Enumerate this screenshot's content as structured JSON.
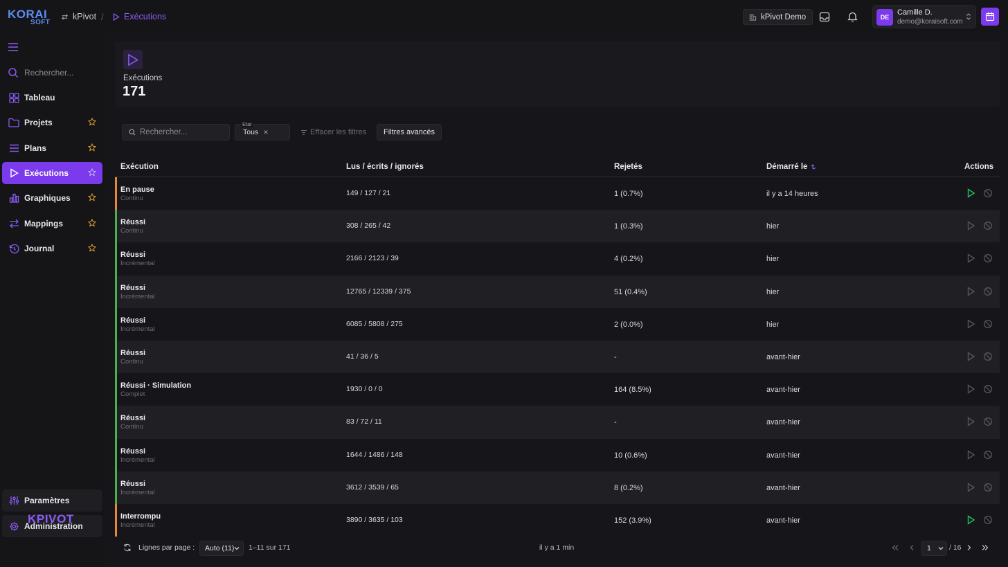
{
  "app": {
    "logo_top": "KORAI",
    "logo_bottom": "SOFT",
    "brand_bottom": "KPIVOT"
  },
  "breadcrumb": {
    "items": [
      {
        "label": "kPivot",
        "icon": "swap-icon"
      },
      {
        "label": "Exécutions",
        "icon": "play-icon"
      }
    ],
    "separator": "/"
  },
  "topbar": {
    "tenant": "kPivot Demo",
    "user": {
      "initials": "DE",
      "name": "Camille D.",
      "email": "demo@koraisoft.com"
    }
  },
  "sidebar": {
    "search_placeholder": "Rechercher...",
    "items": [
      {
        "label": "Tableau",
        "icon": "dashboard-icon",
        "star": false
      },
      {
        "label": "Projets",
        "icon": "folder-icon",
        "star": true
      },
      {
        "label": "Plans",
        "icon": "list-icon",
        "star": true
      },
      {
        "label": "Exécutions",
        "icon": "play-icon",
        "star": true,
        "active": true
      },
      {
        "label": "Graphiques",
        "icon": "chart-icon",
        "star": true
      },
      {
        "label": "Mappings",
        "icon": "arrows-icon",
        "star": true
      },
      {
        "label": "Journal",
        "icon": "history-icon",
        "star": true
      }
    ],
    "bottom": [
      {
        "label": "Paramètres",
        "icon": "sliders-icon"
      },
      {
        "label": "Administration",
        "icon": "gear-icon"
      }
    ]
  },
  "header": {
    "label": "Exécutions",
    "count": "171"
  },
  "filters": {
    "search_placeholder": "Rechercher...",
    "state_label": "Etat",
    "state_value": "Tous",
    "clear_label": "Effacer les filtres",
    "advanced_label": "Filtres avancés"
  },
  "table": {
    "columns": {
      "execution": "Exécution",
      "read_written_ignored": "Lus / écrits / ignorés",
      "rejected": "Rejetés",
      "started": "Démarré le",
      "actions": "Actions"
    },
    "rows": [
      {
        "status": "En pause",
        "mode": "Continu",
        "lus": "149 / 127 / 21",
        "rejected": "1 (0.7%)",
        "started": "il y a 14 heures",
        "color": "#e8893a",
        "can_play": true
      },
      {
        "status": "Réussi",
        "mode": "Continu",
        "lus": "308 / 265 / 42",
        "rejected": "1 (0.3%)",
        "started": "hier",
        "color": "#4caf50",
        "can_play": false
      },
      {
        "status": "Réussi",
        "mode": "Incrémental",
        "lus": "2166 / 2123 / 39",
        "rejected": "4 (0.2%)",
        "started": "hier",
        "color": "#4caf50",
        "can_play": false
      },
      {
        "status": "Réussi",
        "mode": "Incrémental",
        "lus": "12765 / 12339 / 375",
        "rejected": "51 (0.4%)",
        "started": "hier",
        "color": "#4caf50",
        "can_play": false
      },
      {
        "status": "Réussi",
        "mode": "Incrémental",
        "lus": "6085 / 5808 / 275",
        "rejected": "2 (0.0%)",
        "started": "hier",
        "color": "#4caf50",
        "can_play": false
      },
      {
        "status": "Réussi",
        "mode": "Continu",
        "lus": "41 / 36 / 5",
        "rejected": "-",
        "started": "avant-hier",
        "color": "#4caf50",
        "can_play": false
      },
      {
        "status": "Réussi · Simulation",
        "mode": "Complet",
        "lus": "1930 / 0 / 0",
        "rejected": "164 (8.5%)",
        "started": "avant-hier",
        "color": "#4caf50",
        "can_play": false
      },
      {
        "status": "Réussi",
        "mode": "Continu",
        "lus": "83 / 72 / 11",
        "rejected": "-",
        "started": "avant-hier",
        "color": "#4caf50",
        "can_play": false
      },
      {
        "status": "Réussi",
        "mode": "Incrémental",
        "lus": "1644 / 1486 / 148",
        "rejected": "10 (0.6%)",
        "started": "avant-hier",
        "color": "#4caf50",
        "can_play": false
      },
      {
        "status": "Réussi",
        "mode": "Incrémental",
        "lus": "3612 / 3539 / 65",
        "rejected": "8 (0.2%)",
        "started": "avant-hier",
        "color": "#4caf50",
        "can_play": false
      },
      {
        "status": "Interrompu",
        "mode": "Incrémental",
        "lus": "3890 / 3635 / 103",
        "rejected": "152 (3.9%)",
        "started": "avant-hier",
        "color": "#e8893a",
        "can_play": true
      }
    ]
  },
  "footer": {
    "rows_per_page_label": "Lignes par page :",
    "rows_per_page_value": "Auto (11)",
    "range": "1–11 sur 171",
    "updated": "il y a 1 min",
    "page": "1",
    "total_pages": "/ 16"
  },
  "colors": {
    "accent": "#7c3aed",
    "play_active": "#22c55e",
    "warn": "#e8893a",
    "success": "#4caf50"
  }
}
